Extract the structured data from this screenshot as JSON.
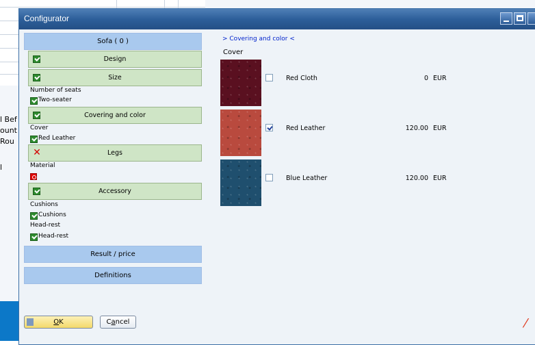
{
  "window": {
    "title": "Configurator"
  },
  "background": {
    "labels": [
      "l Bef",
      "ount",
      "Rou",
      "l"
    ]
  },
  "left": {
    "header": "Sofa  ( 0 )",
    "sections": [
      {
        "label": "Design",
        "status": "ok"
      },
      {
        "label": "Size",
        "status": "ok"
      },
      {
        "label": "Covering and color",
        "status": "ok"
      },
      {
        "label": "Legs",
        "status": "error"
      },
      {
        "label": "Accessory",
        "status": "ok"
      }
    ],
    "size": {
      "field": "Number of seats",
      "value": "Two-seater"
    },
    "covering": {
      "field": "Cover",
      "value": "Red Leather"
    },
    "legs": {
      "field": "Material"
    },
    "accessory": {
      "cushions_field": "Cushions",
      "cushions_value": "Cushions",
      "headrest_field": "Head-rest",
      "headrest_value": "Head-rest"
    },
    "result_button": "Result / price",
    "definitions_button": "Definitions"
  },
  "right": {
    "breadcrumb": "> Covering and color <",
    "group_label": "Cover",
    "options": [
      {
        "name": "Red Cloth",
        "price": "0",
        "currency": "EUR",
        "checked": false,
        "color": "#5a1020"
      },
      {
        "name": "Red Leather",
        "price": "120.00",
        "currency": "EUR",
        "checked": true,
        "color": "#b94a3e"
      },
      {
        "name": "Blue Leather",
        "price": "120.00",
        "currency": "EUR",
        "checked": false,
        "color": "#1f4f6e"
      }
    ]
  },
  "footer": {
    "ok_pre": "",
    "ok_underline": "O",
    "ok_post": "K",
    "cancel_pre": "C",
    "cancel_underline": "a",
    "cancel_post": "ncel"
  }
}
